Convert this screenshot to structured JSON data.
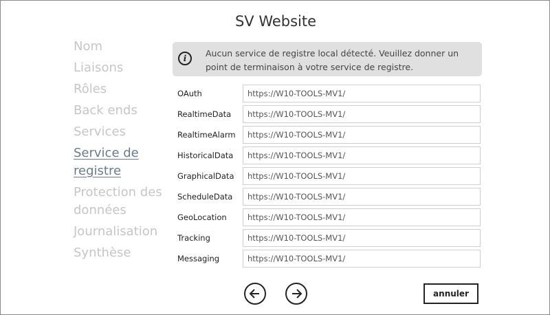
{
  "window": {
    "title": "SV Website"
  },
  "sidebar": {
    "items": [
      {
        "label": "Nom",
        "active": false
      },
      {
        "label": "Liaisons",
        "active": false
      },
      {
        "label": "Rôles",
        "active": false
      },
      {
        "label": "Back ends",
        "active": false
      },
      {
        "label": "Services",
        "active": false
      },
      {
        "label": "Service de registre",
        "active": true
      },
      {
        "label": "Protection des données",
        "active": false
      },
      {
        "label": "Journalisation",
        "active": false
      },
      {
        "label": "Synthèse",
        "active": false
      }
    ]
  },
  "info": {
    "icon": "info-icon",
    "text": "Aucun service de registre local détecté. Veuillez donner un point de terminaison à votre service de registre."
  },
  "endpoints": [
    {
      "label": "OAuth",
      "value": "https://W10-TOOLS-MV1/"
    },
    {
      "label": "RealtimeData",
      "value": "https://W10-TOOLS-MV1/"
    },
    {
      "label": "RealtimeAlarm",
      "value": "https://W10-TOOLS-MV1/"
    },
    {
      "label": "HistoricalData",
      "value": "https://W10-TOOLS-MV1/"
    },
    {
      "label": "GraphicalData",
      "value": "https://W10-TOOLS-MV1/"
    },
    {
      "label": "ScheduleData",
      "value": "https://W10-TOOLS-MV1/"
    },
    {
      "label": "GeoLocation",
      "value": "https://W10-TOOLS-MV1/"
    },
    {
      "label": "Tracking",
      "value": "https://W10-TOOLS-MV1/"
    },
    {
      "label": "Messaging",
      "value": "https://W10-TOOLS-MV1/"
    }
  ],
  "footer": {
    "back_icon": "arrow-left-icon",
    "next_icon": "arrow-right-icon",
    "cancel_label": "annuler"
  },
  "colors": {
    "nav_inactive": "#c6c6c6",
    "nav_active": "#6b7b8c",
    "info_background": "#e0e0e0"
  }
}
